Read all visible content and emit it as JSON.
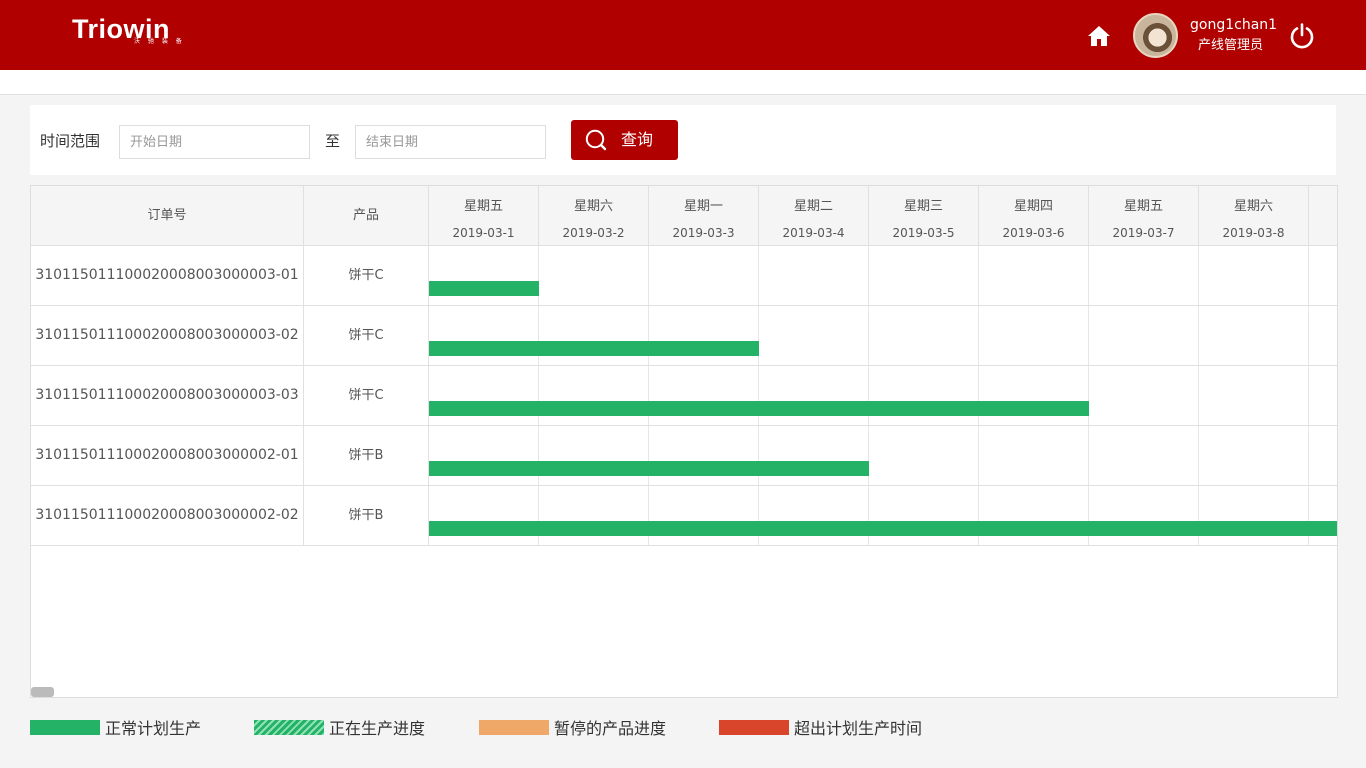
{
  "header": {
    "logo_text": "Triowin",
    "logo_sub": "沃 驰 装 备",
    "home_icon": "home-icon",
    "user_name": "gong1chan1",
    "user_role": "产线管理员",
    "power_icon": "power-icon"
  },
  "filter": {
    "range_label": "时间范围",
    "start_placeholder": "开始日期",
    "to_label": "至",
    "end_placeholder": "结束日期",
    "query_label": "查询",
    "query_icon": "search-icon"
  },
  "table": {
    "col_order": "订单号",
    "col_product": "产品",
    "days": [
      {
        "weekday": "星期五",
        "date": "2019-03-1"
      },
      {
        "weekday": "星期六",
        "date": "2019-03-2"
      },
      {
        "weekday": "星期一",
        "date": "2019-03-3"
      },
      {
        "weekday": "星期二",
        "date": "2019-03-4"
      },
      {
        "weekday": "星期三",
        "date": "2019-03-5"
      },
      {
        "weekday": "星期四",
        "date": "2019-03-6"
      },
      {
        "weekday": "星期五",
        "date": "2019-03-7"
      },
      {
        "weekday": "星期六",
        "date": "2019-03-8"
      }
    ],
    "rows": [
      {
        "order": "310115011100020008003000003-01",
        "product": "饼干C",
        "span_days": 1,
        "status": "normal"
      },
      {
        "order": "310115011100020008003000003-02",
        "product": "饼干C",
        "span_days": 3,
        "status": "normal"
      },
      {
        "order": "310115011100020008003000003-03",
        "product": "饼干C",
        "span_days": 6,
        "status": "normal"
      },
      {
        "order": "310115011100020008003000002-01",
        "product": "饼干B",
        "span_days": 4,
        "status": "normal"
      },
      {
        "order": "310115011100020008003000002-02",
        "product": "饼干B",
        "span_days": 8.25,
        "status": "normal"
      }
    ]
  },
  "legend": [
    {
      "label": "正常计划生产",
      "color": "#24b366",
      "style": "solid"
    },
    {
      "label": "正在生产进度",
      "color": "#24b366",
      "style": "hatched"
    },
    {
      "label": "暂停的产品进度",
      "color": "#f0a868",
      "style": "solid"
    },
    {
      "label": "超出计划生产时间",
      "color": "#d9452b",
      "style": "solid"
    }
  ]
}
